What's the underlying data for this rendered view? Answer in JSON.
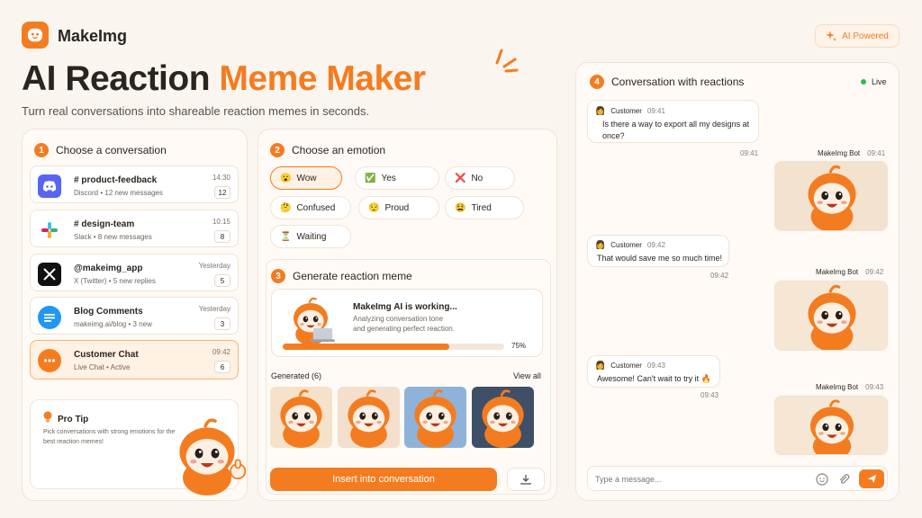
{
  "header": {
    "brand": "MakeImg",
    "ai_badge": "AI Powered",
    "title_part1": "AI Reaction",
    "title_part2": "Meme Maker",
    "subtitle": "Turn real conversations into shareable reaction memes in seconds."
  },
  "step1": {
    "num": "1",
    "title": "Choose a conversation",
    "items": [
      {
        "name": "# product-feedback",
        "meta": "Discord • 12 new messages",
        "time": "14:30",
        "count": "12",
        "icon": "discord-icon",
        "color": "#5865f2"
      },
      {
        "name": "# design-team",
        "meta": "Slack • 8 new messages",
        "time": "10:15",
        "count": "8",
        "icon": "slack-icon",
        "color": "#ffffff"
      },
      {
        "name": "@makeimg_app",
        "meta": "X (Twitter) • 5 new replies",
        "time": "Yesterday",
        "count": "5",
        "icon": "x-twitter-icon",
        "color": "#111111"
      },
      {
        "name": "Blog Comments",
        "meta": "makeimg.ai/blog • 3 new",
        "time": "Yesterday",
        "count": "3",
        "icon": "comment-icon",
        "color": "#2196f3"
      },
      {
        "name": "Customer Chat",
        "meta": "Live Chat • Active",
        "time": "09:42",
        "count": "6",
        "icon": "chat-icon",
        "color": "#f47c20"
      }
    ],
    "tip_title": "Pro Tip",
    "tip_text": "Pick conversations with strong emotions for the best reaction memes!"
  },
  "step2": {
    "num": "2",
    "title": "Choose an emotion",
    "emotions": [
      {
        "emoji": "😮",
        "label": "Wow",
        "selected": true
      },
      {
        "emoji": "✅",
        "label": "Yes"
      },
      {
        "emoji": "❌",
        "label": "No"
      },
      {
        "emoji": "🤔",
        "label": "Confused"
      },
      {
        "emoji": "😌",
        "label": "Proud"
      },
      {
        "emoji": "😫",
        "label": "Tired"
      },
      {
        "emoji": "⏳",
        "label": "Waiting"
      }
    ]
  },
  "step3": {
    "num": "3",
    "title": "Generate reaction meme",
    "working_title": "MakeImg AI is working...",
    "working_line1": "Analyzing conversation tone",
    "working_line2": "and generating perfect reaction.",
    "progress": 0.75,
    "progress_label": "75%",
    "generated_label": "Generated (6)",
    "view_all": "View all",
    "insert_button": "Insert into conversation"
  },
  "step4": {
    "num": "4",
    "title": "Conversation with reactions",
    "live": "Live",
    "messages": [
      {
        "sender": "Customer",
        "time": "09:41",
        "text": "Is there a way to export all my designs at once?",
        "reply_time": "09:41"
      },
      {
        "sender": "Customer",
        "time": "09:42",
        "text": "That would save me so much time!",
        "reply_time": "09:42"
      },
      {
        "sender": "Customer",
        "time": "09:43",
        "text": "Awesome! Can't wait to try it 🔥",
        "reply_time": "09:43"
      }
    ],
    "bot_name": "MakeImg Bot",
    "bot_times": [
      "09:41",
      "09:42",
      "09:43"
    ],
    "input_placeholder": "Type a message..."
  },
  "colors": {
    "accent": "#f47c20",
    "bg": "#fbf5ef",
    "live": "#2eb84a"
  }
}
